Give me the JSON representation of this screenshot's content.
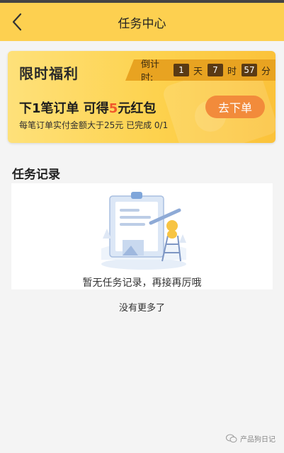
{
  "header": {
    "title": "任务中心",
    "back_icon": "chevron-left-icon"
  },
  "promo": {
    "title": "限时福利",
    "countdown": {
      "label": "倒计时:",
      "days": "1",
      "days_unit": "天",
      "hours": "7",
      "hours_unit": "时",
      "minutes": "57",
      "minutes_unit": "分"
    },
    "task_prefix": "下1笔订单 可得",
    "task_amount": "5",
    "task_suffix": "元红包",
    "task_desc": "每笔订单实付金额大于25元 已完成 0/1",
    "go_button": "去下单"
  },
  "records": {
    "section_title": "任务记录",
    "empty_text": "暂无任务记录，再接再厉哦",
    "no_more": "没有更多了"
  },
  "watermark": {
    "text": "产品狗日记",
    "icon": "wechat-icon"
  },
  "colors": {
    "header": "#fdd050",
    "button": "#f28b3b",
    "highlight": "#f1582b",
    "countdown": "#e8a321"
  }
}
